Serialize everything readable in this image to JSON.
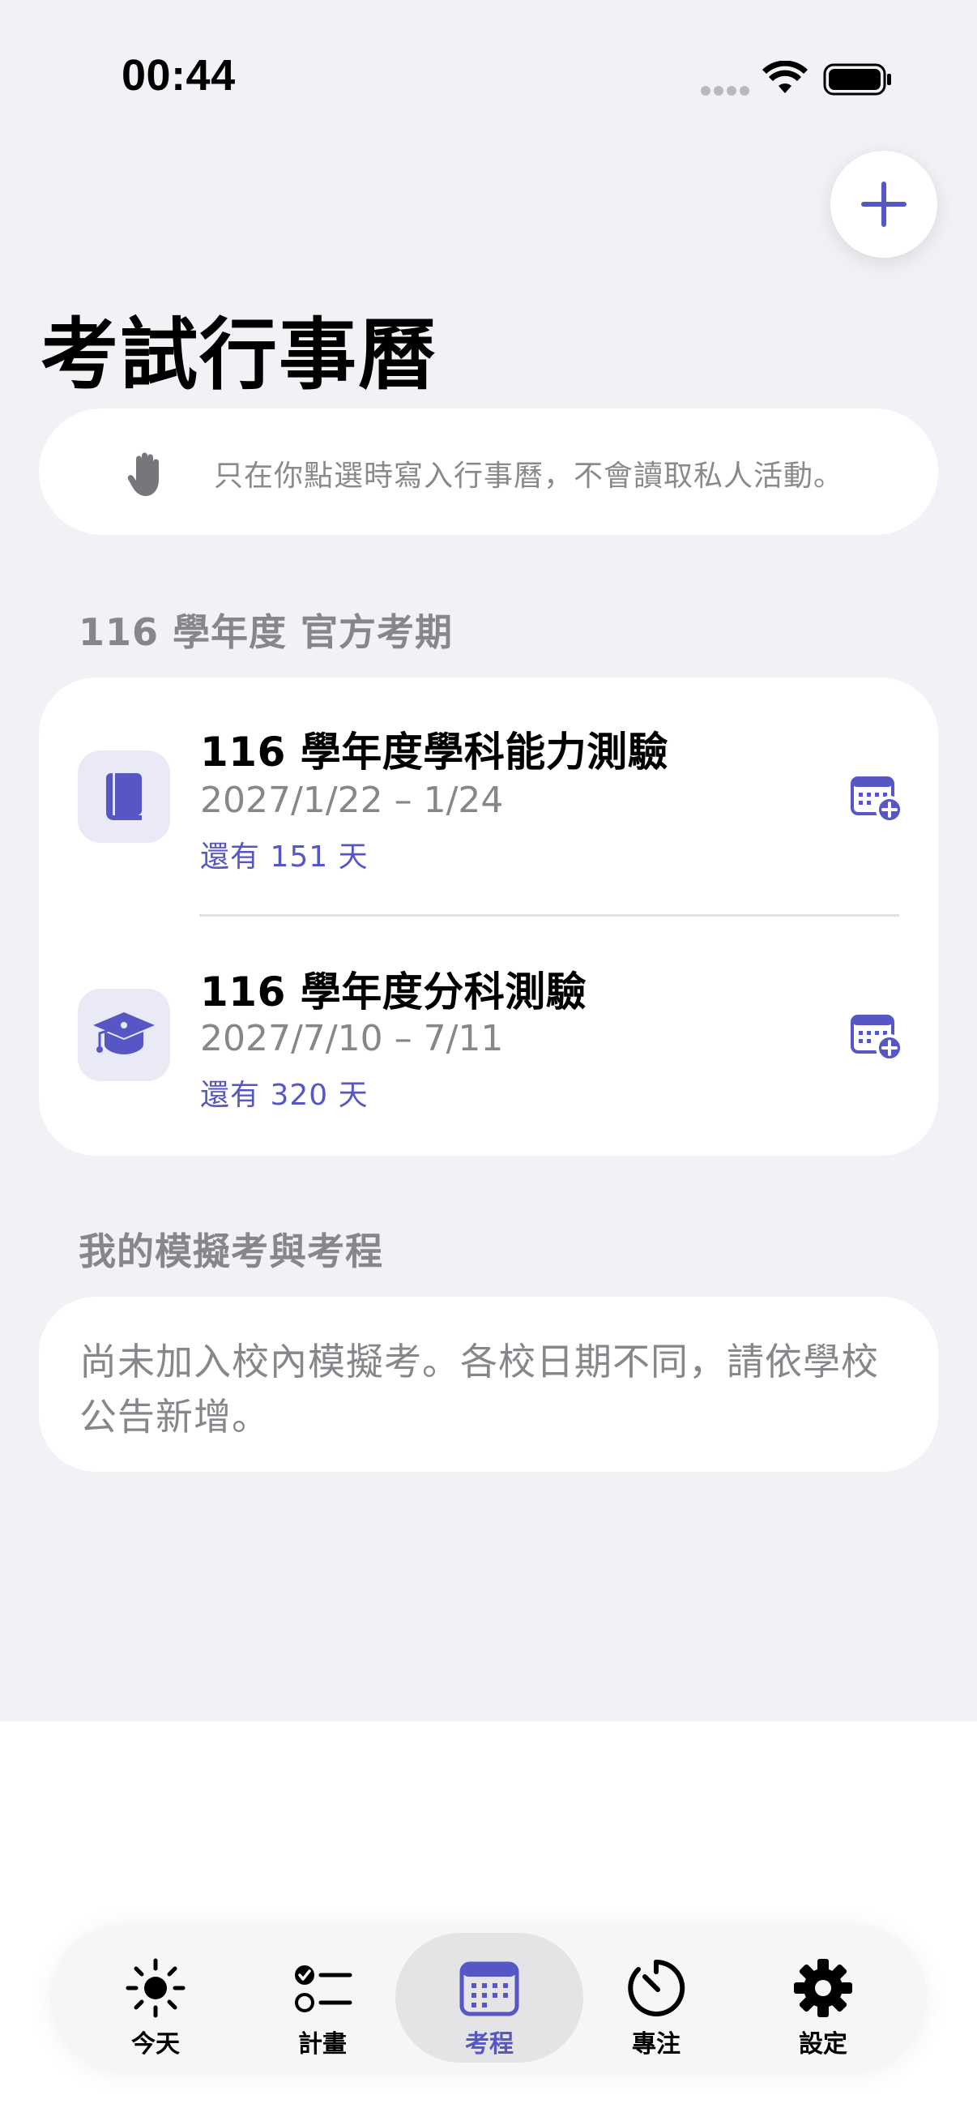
{
  "status_bar": {
    "time": "00:44"
  },
  "page_title": "考試行事曆",
  "privacy_notice": "只在你點選時寫入行事曆，不會讀取私人活動。",
  "official_section": {
    "header": "116 學年度 官方考期",
    "exams": [
      {
        "name": "116 學年度學科能力測驗",
        "date": "2027/1/22 – 1/24",
        "countdown": "還有 151 天",
        "icon": "book-icon"
      },
      {
        "name": "116 學年度分科測驗",
        "date": "2027/7/10 – 7/11",
        "countdown": "還有 320 天",
        "icon": "graduation-cap-icon"
      }
    ]
  },
  "mock_section": {
    "header": "我的模擬考與考程",
    "empty_text": "尚未加入校內模擬考。各校日期不同，請依學校公告新增。"
  },
  "tab_bar": {
    "tabs": [
      {
        "label": "今天",
        "icon": "sun-icon"
      },
      {
        "label": "計畫",
        "icon": "checklist-icon"
      },
      {
        "label": "考程",
        "icon": "calendar-icon",
        "active": true
      },
      {
        "label": "專注",
        "icon": "timer-icon"
      },
      {
        "label": "設定",
        "icon": "gear-icon"
      }
    ]
  },
  "colors": {
    "accent": "#5656c4",
    "background": "#f1f1f6",
    "secondary_text": "#86868b"
  }
}
